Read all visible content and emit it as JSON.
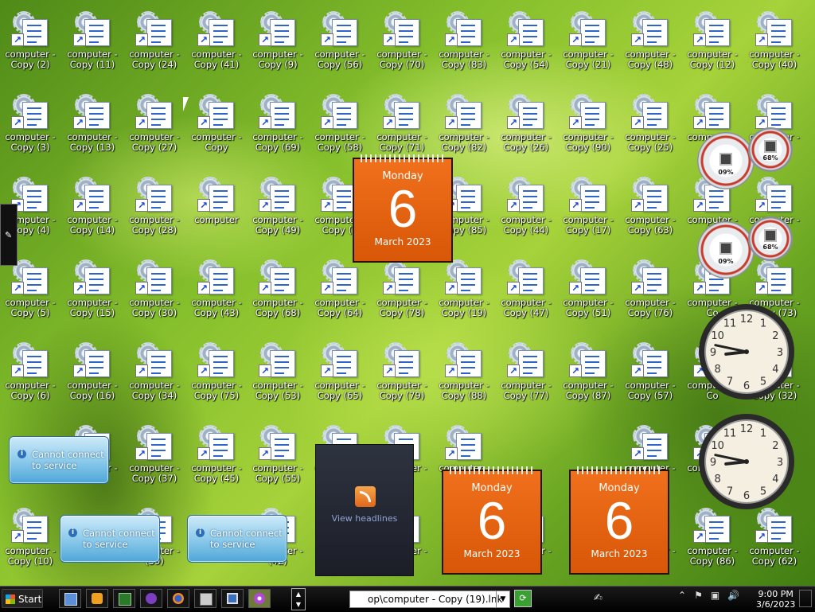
{
  "desktop": {
    "icons": [
      [
        "computer - Copy (2)",
        "computer - Copy (11)",
        "computer - Copy (24)",
        "computer - Copy (41)",
        "computer - Copy (9)",
        "computer - Copy (56)",
        "computer - Copy (70)",
        "computer - Copy (83)",
        "computer - Copy (54)",
        "computer - Copy (21)",
        "computer - Copy (48)",
        "computer - Copy (12)",
        "computer - Copy (40)"
      ],
      [
        "computer - Copy (3)",
        "computer - Copy (13)",
        "computer - Copy (27)",
        "computer - Copy",
        "computer - Copy (69)",
        "computer - Copy (58)",
        "computer - Copy (71)",
        "computer - Copy (82)",
        "computer - Copy (26)",
        "computer - Copy (90)",
        "computer - Copy (25)",
        "computer - Co",
        "computer -"
      ],
      [
        "computer - Copy (4)",
        "computer - Copy (14)",
        "computer - Copy (28)",
        "computer",
        "computer - Copy (49)",
        "computer - Copy (5",
        "",
        "computer - Copy (85)",
        "computer - Copy (44)",
        "computer - Copy (17)",
        "computer - Copy (63)",
        "computer - Co",
        "computer -"
      ],
      [
        "computer - Copy (5)",
        "computer - Copy (15)",
        "computer - Copy (30)",
        "computer - Copy (43)",
        "computer - Copy (68)",
        "computer - Copy (64)",
        "computer - Copy (78)",
        "computer - Copy (19)",
        "computer - Copy (47)",
        "computer - Copy (51)",
        "computer - Copy (76)",
        "computer - Co",
        "computer - Copy (73)"
      ],
      [
        "computer - Copy (6)",
        "computer - Copy (16)",
        "computer - Copy (34)",
        "computer - Copy (75)",
        "computer - Copy (53)",
        "computer - Copy (65)",
        "computer - Copy (79)",
        "computer - Copy (88)",
        "computer - Copy (77)",
        "computer - Copy (87)",
        "computer - Copy (57)",
        "computer - Co",
        "computer - Copy (32)"
      ],
      [
        "",
        "computer - 8)",
        "computer - Copy (37)",
        "computer - Copy (45)",
        "computer - Copy (55)",
        "computer -",
        "computer - 80)",
        "computer -",
        "",
        "",
        "computer - 4)",
        "computer -",
        ""
      ],
      [
        "computer - Copy (10)",
        "",
        "computer - (39)",
        "",
        "computer - (42)",
        "",
        "computer - (31)",
        "",
        "computer - 2)",
        "",
        "computer - 4)",
        "computer - Copy (86)",
        "computer - Copy (62)"
      ]
    ]
  },
  "gadgets": {
    "calendar": {
      "weekday": "Monday",
      "day": "6",
      "month_year": "March 2023"
    },
    "cpu_meter": {
      "cpu": "09%",
      "memory": "68%"
    },
    "clock": {
      "hour": 8,
      "minute": 47
    },
    "weather_message": "Cannot connect to service",
    "feed_link": "View headlines"
  },
  "taskbar": {
    "start_label": "Start",
    "address_value": "op\\computer - Copy (19).lnk",
    "clock_time": "9:00 PM",
    "clock_date": "3/6/2023"
  },
  "colors": {
    "calendar_orange": "#e8620f",
    "taskbar": "#000000",
    "weather_blue": "#88c8ea"
  }
}
